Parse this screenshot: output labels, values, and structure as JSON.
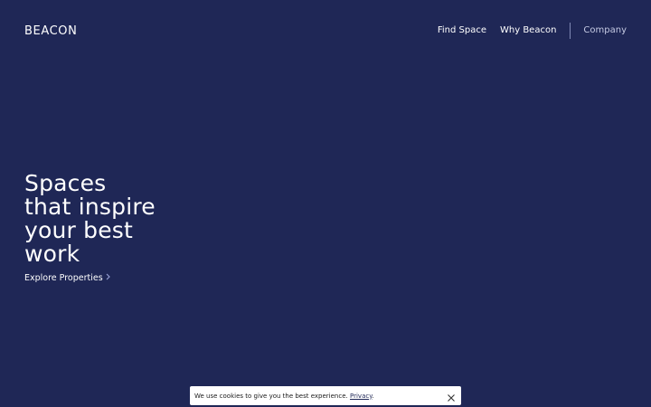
{
  "header": {
    "logo": "BEACON",
    "nav": {
      "find_space": "Find Space",
      "why_beacon": "Why Beacon",
      "company": "Company"
    }
  },
  "hero": {
    "title_lines": [
      "Spaces",
      "that inspire",
      "your best",
      "work"
    ],
    "cta_label": "Explore Properties"
  },
  "cookie_banner": {
    "message": "We use cookies to give you the best experience.",
    "privacy_link": "Privacy",
    "trailing": "."
  },
  "colors": {
    "background": "#1f2756",
    "text": "#ffffff",
    "accent": "#9aa3d6"
  },
  "icons": {
    "cta": "chevron-right-icon",
    "close": "close-icon"
  }
}
